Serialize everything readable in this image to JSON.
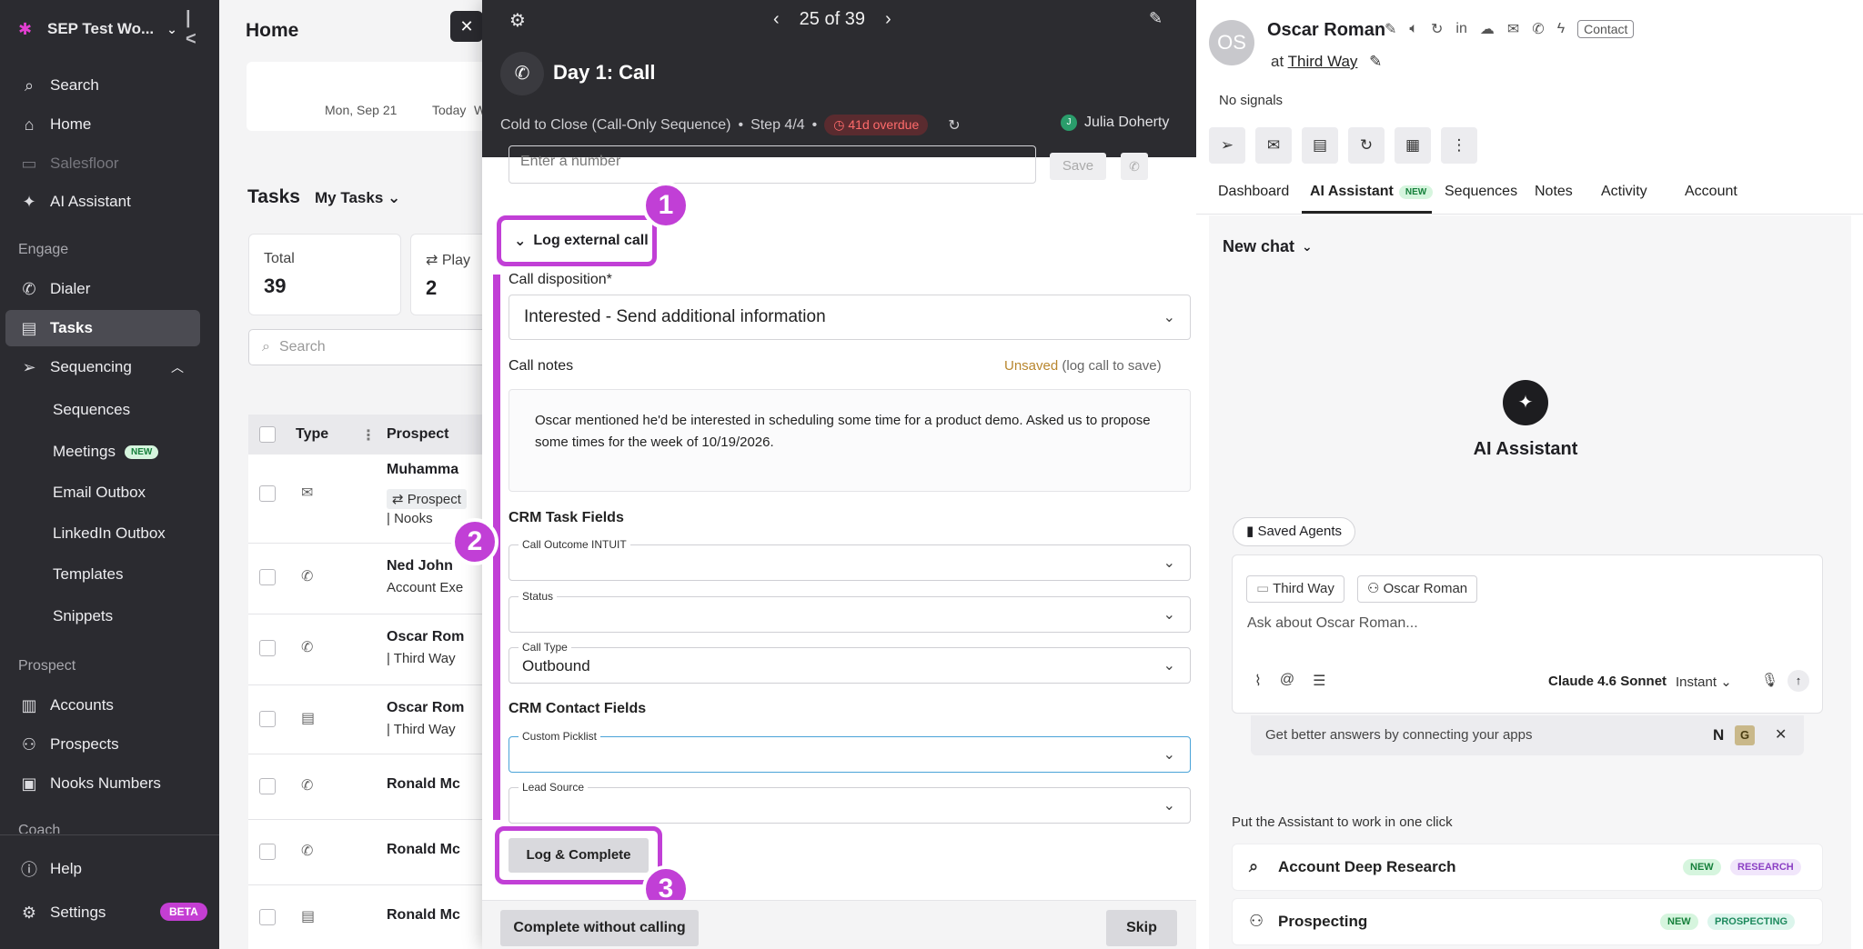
{
  "sidebar": {
    "workspace": "SEP Test Wo...",
    "items": [
      {
        "label": "Search",
        "icon": "search-icon"
      },
      {
        "label": "Home",
        "icon": "home-icon"
      },
      {
        "label": "Salesfloor",
        "icon": "video-icon"
      },
      {
        "label": "AI Assistant",
        "icon": "sparkle-icon"
      }
    ],
    "engage_label": "Engage",
    "dialer": "Dialer",
    "tasks": "Tasks",
    "sequencing": "Sequencing",
    "sub_items": [
      "Sequences",
      "Meetings",
      "Email Outbox",
      "LinkedIn Outbox",
      "Templates",
      "Snippets"
    ],
    "meetings_badge": "NEW",
    "prospect_label": "Prospect",
    "accounts": "Accounts",
    "prospects": "Prospects",
    "nooks_numbers": "Nooks Numbers",
    "coach_label": "Coach",
    "help": "Help",
    "settings": "Settings",
    "beta_badge": "BETA"
  },
  "home": {
    "title": "Home",
    "cal_dates": [
      "Mon, Sep 21",
      "Today",
      "Wed, S"
    ],
    "tasks_title": "Tasks",
    "my_tasks": "My Tasks",
    "stats": [
      {
        "label": "Total",
        "value": "39"
      },
      {
        "label": "Play",
        "value": "2"
      }
    ],
    "search_placeholder": "Search",
    "columns": [
      "Type",
      "Prospect"
    ],
    "rows": [
      {
        "icon": "mail-icon",
        "name": "Muhamma",
        "chip": "Prospect",
        "sub": "| Nooks"
      },
      {
        "icon": "phone-icon",
        "name": "Ned John",
        "sub": "Account Exe"
      },
      {
        "icon": "phone-icon",
        "name": "Oscar Rom",
        "sub": "| Third Way"
      },
      {
        "icon": "clipboard-icon",
        "name": "Oscar Rom",
        "sub": "| Third Way"
      },
      {
        "icon": "phone-icon",
        "name": "Ronald Mc",
        "sub": ""
      },
      {
        "icon": "phone-icon",
        "name": "Ronald Mc",
        "sub": ""
      },
      {
        "icon": "clipboard-icon",
        "name": "Ronald Mc",
        "sub": ""
      }
    ]
  },
  "modal": {
    "pager": "25 of 39",
    "title": "Day 1: Call",
    "sequence": "Cold to Close (Call-Only Sequence)",
    "step": "Step 4/4",
    "overdue": "41d overdue",
    "owner_initial": "J",
    "owner": "Julia Doherty",
    "number_placeholder": "Enter a number",
    "save": "Save",
    "log_external": "Log external call",
    "disposition_label": "Call disposition*",
    "disposition_value": "Interested - Send additional information",
    "notes_label": "Call notes",
    "unsaved": "Unsaved",
    "unsaved_hint": "(log call to save)",
    "notes_text": "Oscar mentioned he'd be interested in scheduling some time for a product demo. Asked us to propose some times for the week of 10/19/2026.",
    "crm_task_fields": "CRM Task Fields",
    "call_outcome_label": "Call Outcome INTUIT",
    "call_outcome_value": "",
    "status_label": "Status",
    "status_value": "",
    "call_type_label": "Call Type",
    "call_type_value": "Outbound",
    "crm_contact_fields": "CRM Contact Fields",
    "custom_picklist_label": "Custom Picklist",
    "custom_picklist_value": "",
    "lead_source_label": "Lead Source",
    "lead_source_value": "",
    "log_complete": "Log & Complete",
    "complete_without": "Complete without calling",
    "skip": "Skip",
    "markers": [
      "1",
      "2",
      "3"
    ]
  },
  "right": {
    "initials": "OS",
    "name": "Oscar Roman",
    "contact": "Contact",
    "at": "at",
    "company": "Third Way",
    "no_signals": "No signals",
    "tabs": [
      "Dashboard",
      "AI Assistant",
      "Sequences",
      "Notes",
      "Activity",
      "Account"
    ],
    "ai_badge": "NEW",
    "new_chat": "New chat",
    "ai_title": "AI Assistant",
    "saved_agents": "Saved Agents",
    "chip_company": "Third Way",
    "chip_person": "Oscar Roman",
    "composer_placeholder": "Ask about Oscar Roman...",
    "model": "Claude 4.6 Sonnet",
    "mode": "Instant",
    "connect": "Get better answers by connecting your apps",
    "connect_n": "N",
    "connect_g": "G",
    "put_label": "Put the Assistant to work in one click",
    "agents": [
      {
        "name": "Account Deep Research",
        "new": "NEW",
        "tag": "RESEARCH"
      },
      {
        "name": "Prospecting",
        "new": "NEW",
        "tag": "PROSPECTING"
      }
    ]
  }
}
